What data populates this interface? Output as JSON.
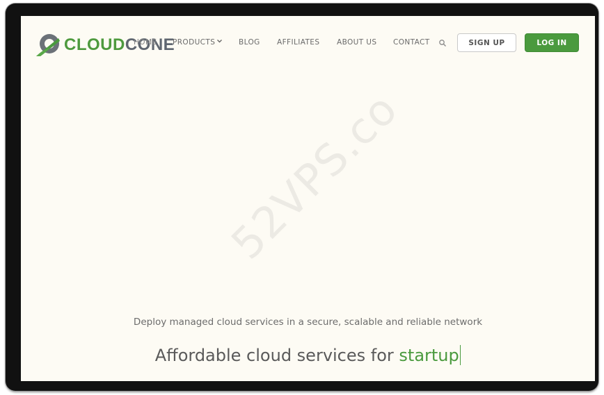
{
  "brand": {
    "name_part1": "CLOUD",
    "name_part2": "CONE",
    "colors": {
      "green": "#4a9a3e",
      "gray": "#5f6670",
      "background": "#fdfbf4"
    },
    "logo_icon": "cloudcone-logo-icon"
  },
  "nav": {
    "items": [
      {
        "label": "HOME"
      },
      {
        "label": "PRODUCTS",
        "icon": "chevron-down-icon"
      },
      {
        "label": "BLOG"
      },
      {
        "label": "AFFILIATES"
      },
      {
        "label": "ABOUT US"
      },
      {
        "label": "CONTACT"
      }
    ],
    "search_icon": "search-icon",
    "signup_label": "SIGN UP",
    "login_label": "LOG IN"
  },
  "watermark": "52VPS.com",
  "hero": {
    "subtitle": "Deploy managed cloud services in a secure, scalable and reliable network",
    "headline_prefix": "Affordable cloud services for ",
    "headline_accent": "startup"
  }
}
